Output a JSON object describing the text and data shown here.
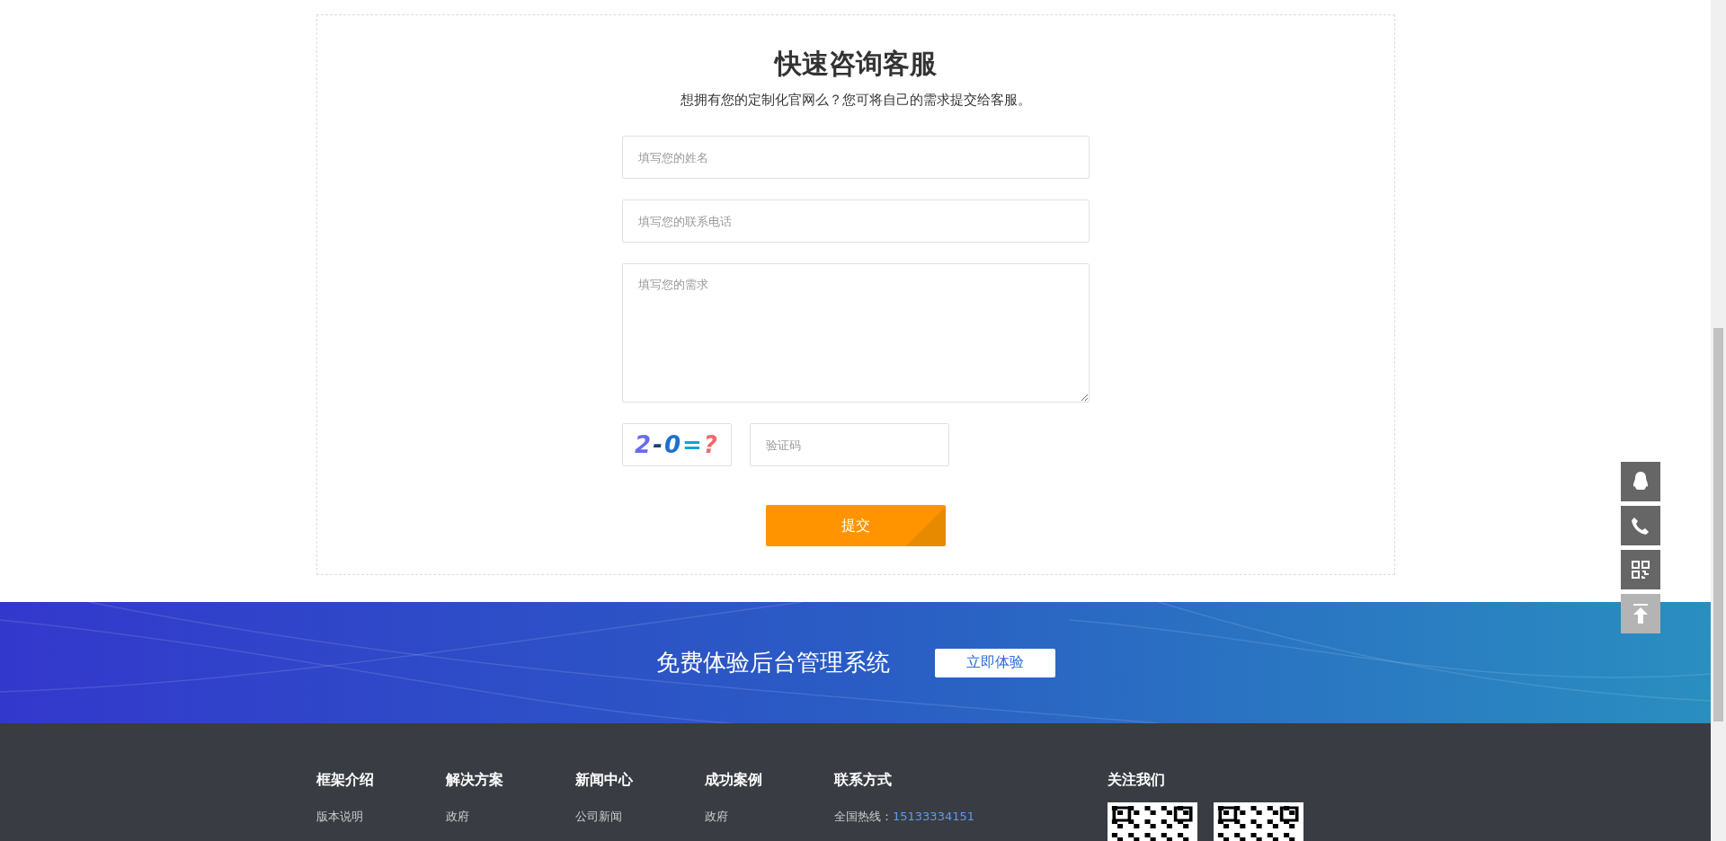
{
  "consult": {
    "title": "快速咨询客服",
    "subtitle": "想拥有您的定制化官网么？您可将自己的需求提交给客服。",
    "fields": [
      {
        "kind": "input",
        "placeholder": "填写您的姓名"
      },
      {
        "kind": "input",
        "placeholder": "填写您的联系电话"
      },
      {
        "kind": "textarea",
        "placeholder": "填写您的需求"
      }
    ],
    "captcha": {
      "text": "2-0=?",
      "placeholder": "验证码"
    },
    "submit": "提交"
  },
  "banner": {
    "text": "免费体验后台管理系统",
    "button": "立即体验"
  },
  "side_tools": [
    {
      "kind": "qq"
    },
    {
      "kind": "phone"
    },
    {
      "kind": "qrcode"
    },
    {
      "kind": "top"
    }
  ],
  "footer": {
    "columns": [
      {
        "heading": "框架介绍",
        "links": [
          "版本说明"
        ]
      },
      {
        "heading": "解决方案",
        "links": [
          "政府"
        ]
      },
      {
        "heading": "新闻中心",
        "links": [
          "公司新闻"
        ]
      },
      {
        "heading": "成功案例",
        "links": [
          "政府"
        ]
      }
    ],
    "contact": {
      "heading": "联系方式",
      "lines": [
        {
          "label": "全国热线：",
          "value": "15133334151"
        }
      ]
    },
    "follow": {
      "heading": "关注我们",
      "qr_codes": [
        {
          "kind": "qr"
        },
        {
          "kind": "qr"
        }
      ]
    }
  }
}
